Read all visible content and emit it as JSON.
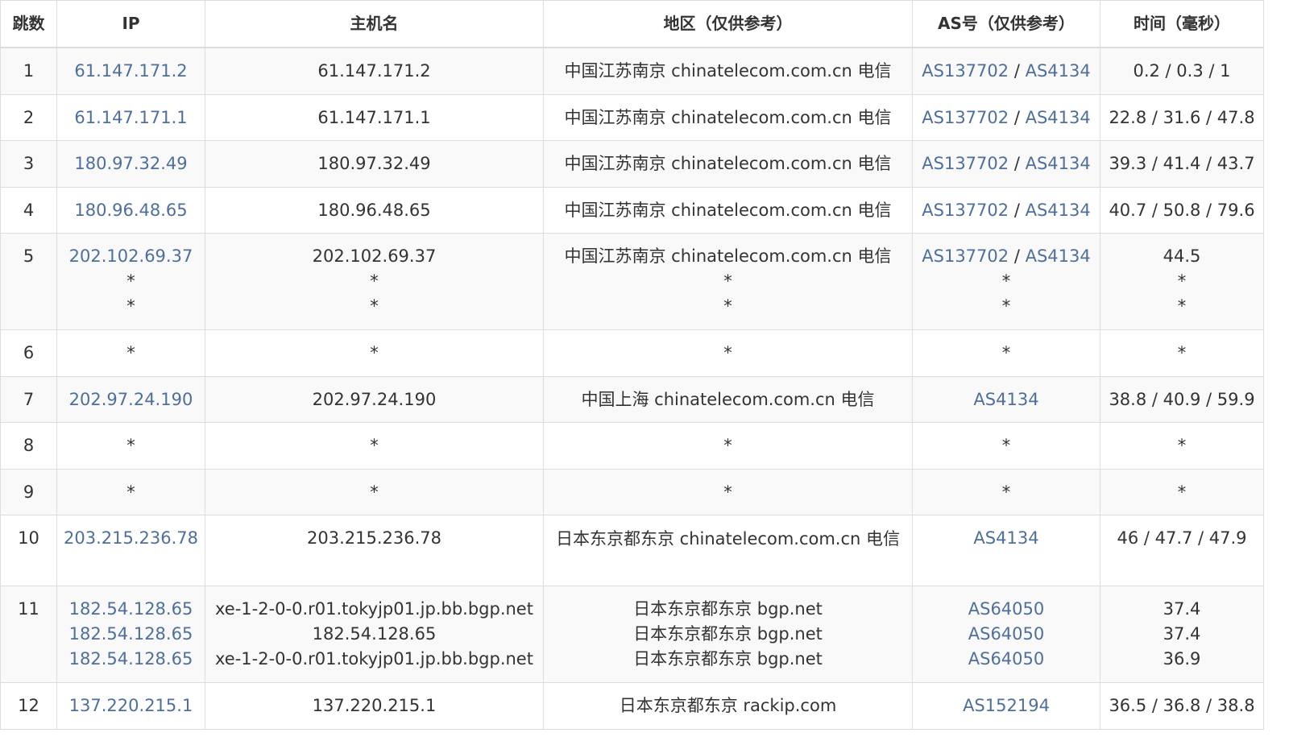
{
  "headers": [
    "跳数",
    "IP",
    "主机名",
    "地区（仅供参考）",
    "AS号（仅供参考）",
    "时间（毫秒）"
  ],
  "rows": [
    {
      "hop": "1",
      "ip": [
        "61.147.171.2"
      ],
      "host": [
        "61.147.171.2"
      ],
      "region": [
        "中国江苏南京 chinatelecom.com.cn 电信"
      ],
      "as": [
        [
          "AS137702",
          "AS4134"
        ]
      ],
      "time": [
        "0.2 / 0.3 / 1"
      ]
    },
    {
      "hop": "2",
      "ip": [
        "61.147.171.1"
      ],
      "host": [
        "61.147.171.1"
      ],
      "region": [
        "中国江苏南京 chinatelecom.com.cn 电信"
      ],
      "as": [
        [
          "AS137702",
          "AS4134"
        ]
      ],
      "time": [
        "22.8 / 31.6 / 47.8"
      ]
    },
    {
      "hop": "3",
      "ip": [
        "180.97.32.49"
      ],
      "host": [
        "180.97.32.49"
      ],
      "region": [
        "中国江苏南京 chinatelecom.com.cn 电信"
      ],
      "as": [
        [
          "AS137702",
          "AS4134"
        ]
      ],
      "time": [
        "39.3 / 41.4 / 43.7"
      ]
    },
    {
      "hop": "4",
      "ip": [
        "180.96.48.65"
      ],
      "host": [
        "180.96.48.65"
      ],
      "region": [
        "中国江苏南京 chinatelecom.com.cn 电信"
      ],
      "as": [
        [
          "AS137702",
          "AS4134"
        ]
      ],
      "time": [
        "40.7 / 50.8 / 79.6"
      ]
    },
    {
      "hop": "5",
      "ip": [
        "202.102.69.37",
        "*",
        "*"
      ],
      "host": [
        "202.102.69.37",
        "*",
        "*"
      ],
      "region": [
        "中国江苏南京 chinatelecom.com.cn 电信",
        "*",
        "*"
      ],
      "as": [
        [
          "AS137702",
          "AS4134"
        ],
        [
          "*"
        ],
        [
          "*"
        ]
      ],
      "time": [
        "44.5",
        "*",
        "*"
      ]
    },
    {
      "hop": "6",
      "ip": [
        "*"
      ],
      "host": [
        "*"
      ],
      "region": [
        "*"
      ],
      "as": [
        [
          "*"
        ]
      ],
      "time": [
        "*"
      ]
    },
    {
      "hop": "7",
      "ip": [
        "202.97.24.190"
      ],
      "host": [
        "202.97.24.190"
      ],
      "region": [
        "中国上海 chinatelecom.com.cn 电信"
      ],
      "as": [
        [
          "AS4134"
        ]
      ],
      "time": [
        "38.8 / 40.9 / 59.9"
      ]
    },
    {
      "hop": "8",
      "ip": [
        "*"
      ],
      "host": [
        "*"
      ],
      "region": [
        "*"
      ],
      "as": [
        [
          "*"
        ]
      ],
      "time": [
        "*"
      ]
    },
    {
      "hop": "9",
      "ip": [
        "*"
      ],
      "host": [
        "*"
      ],
      "region": [
        "*"
      ],
      "as": [
        [
          "*"
        ]
      ],
      "time": [
        "*"
      ]
    },
    {
      "hop": "10",
      "ip": [
        "203.215.236.78"
      ],
      "host": [
        "203.215.236.78"
      ],
      "region": [
        "日本东京都东京 chinatelecom.com.cn 电信"
      ],
      "as": [
        [
          "AS4134"
        ]
      ],
      "time": [
        "46 / 47.7 / 47.9"
      ],
      "region_wrap": true
    },
    {
      "hop": "11",
      "ip": [
        "182.54.128.65",
        "182.54.128.65",
        "182.54.128.65"
      ],
      "host": [
        "xe-1-2-0-0.r01.tokyjp01.jp.bb.bgp.net",
        "182.54.128.65",
        "xe-1-2-0-0.r01.tokyjp01.jp.bb.bgp.net"
      ],
      "region": [
        "日本东京都东京 bgp.net",
        "日本东京都东京 bgp.net",
        "日本东京都东京 bgp.net"
      ],
      "as": [
        [
          "AS64050"
        ],
        [
          "AS64050"
        ],
        [
          "AS64050"
        ]
      ],
      "time": [
        "37.4",
        "37.4",
        "36.9"
      ]
    },
    {
      "hop": "12",
      "ip": [
        "137.220.215.1"
      ],
      "host": [
        "137.220.215.1"
      ],
      "region": [
        "日本东京都东京 rackip.com"
      ],
      "as": [
        [
          "AS152194"
        ]
      ],
      "time": [
        "36.5 / 36.8 / 38.8"
      ]
    }
  ],
  "colors": {
    "link": "#4e6f9e",
    "border": "#dddddd",
    "stripe": "#f9f9f9",
    "text": "#333333"
  }
}
